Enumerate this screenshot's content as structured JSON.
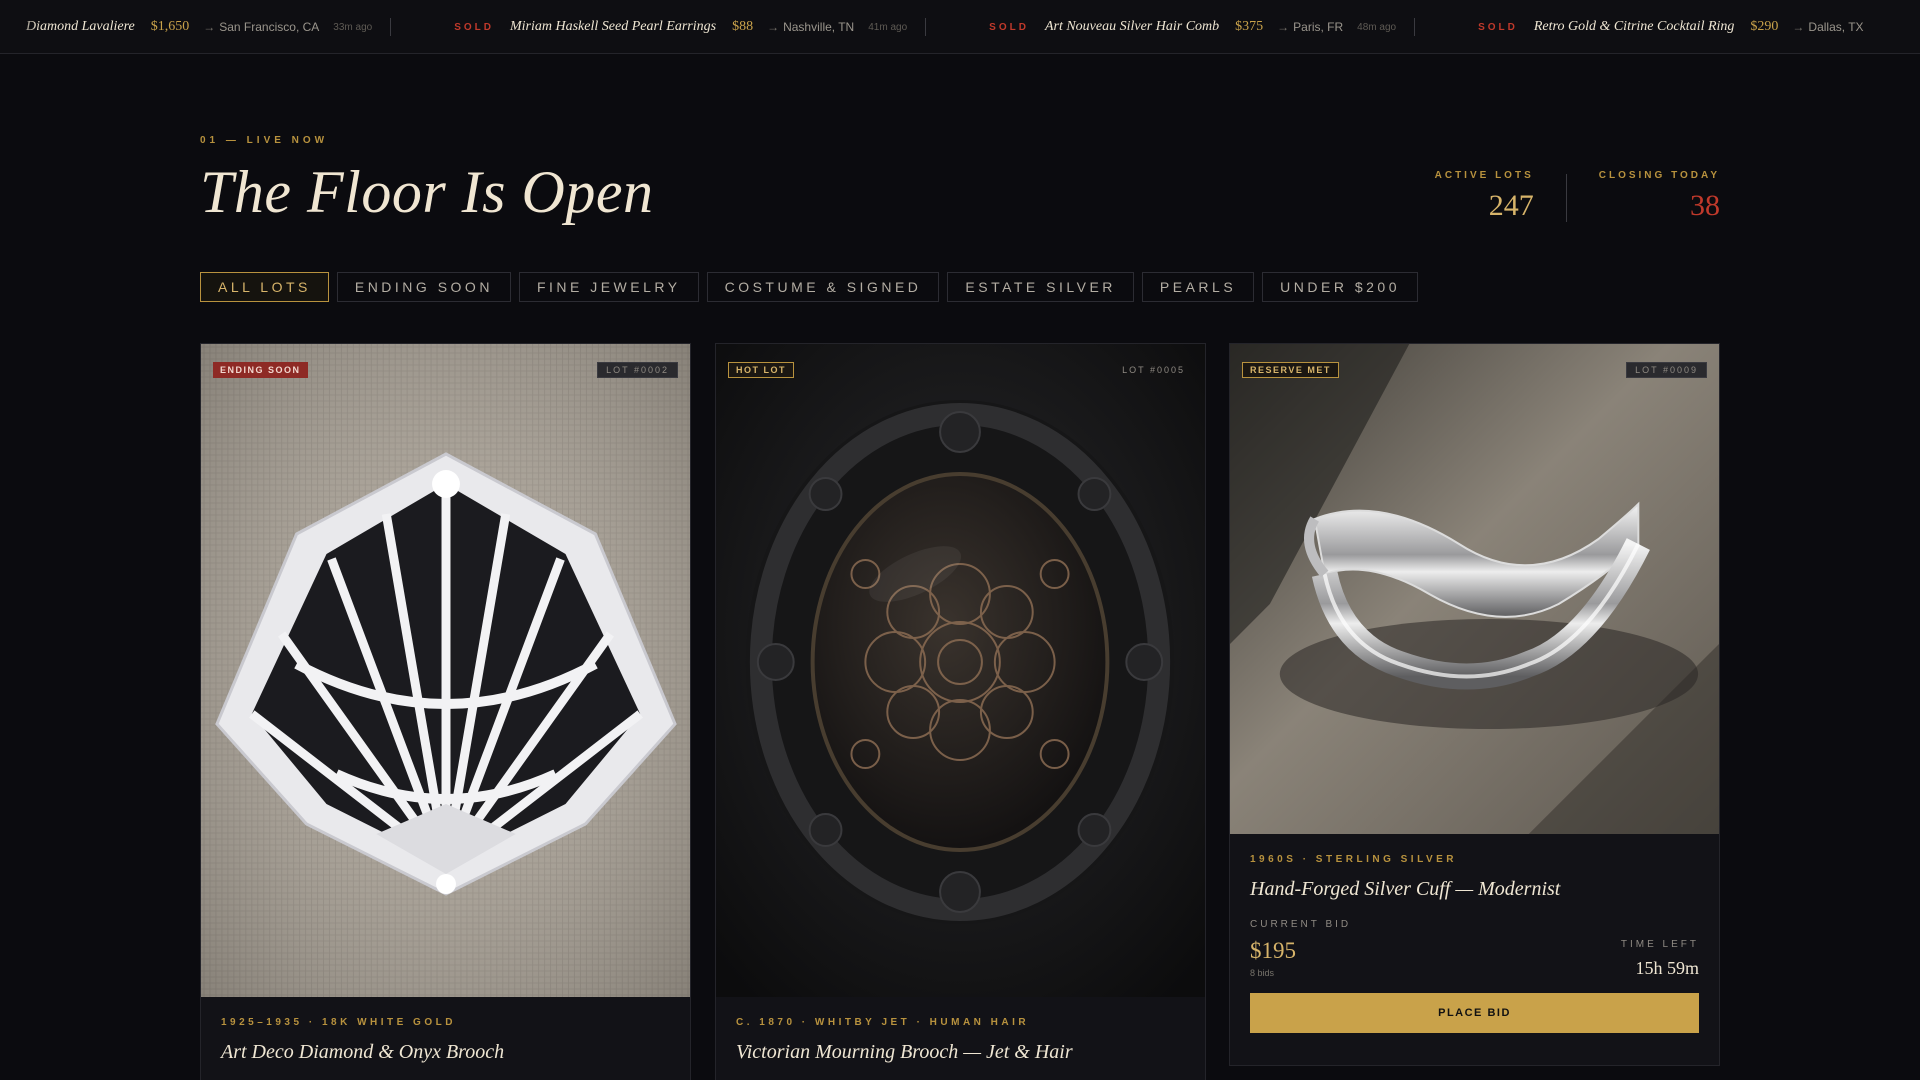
{
  "ticker": {
    "items": [
      {
        "status": "",
        "name": "Diamond Lavaliere",
        "price": "$1,650",
        "location": "San Francisco, CA",
        "time": "33m ago"
      },
      {
        "status": "SOLD",
        "name": "Miriam Haskell Seed Pearl Earrings",
        "price": "$88",
        "location": "Nashville, TN",
        "time": "41m ago"
      },
      {
        "status": "SOLD",
        "name": "Art Nouveau Silver Hair Comb",
        "price": "$375",
        "location": "Paris, FR",
        "time": "48m ago"
      },
      {
        "status": "SOLD",
        "name": "Retro Gold & Citrine Cocktail Ring",
        "price": "$290",
        "location": "Dallas, TX",
        "time": ""
      }
    ]
  },
  "header": {
    "eyebrow": "01 — LIVE NOW",
    "title": "The Floor Is Open"
  },
  "stats": {
    "active_label": "ACTIVE LOTS",
    "active_value": "247",
    "closing_label": "CLOSING TODAY",
    "closing_value": "38"
  },
  "filters": [
    "ALL LOTS",
    "ENDING SOON",
    "FINE JEWELRY",
    "COSTUME & SIGNED",
    "ESTATE SILVER",
    "PEARLS",
    "UNDER $200"
  ],
  "cards": [
    {
      "badge": "ENDING SOON",
      "lot": "LOT #0002",
      "meta": "1925–1935 · 18K WHITE GOLD",
      "title": "Art Deco Diamond & Onyx Brooch"
    },
    {
      "badge": "HOT LOT",
      "lot": "LOT #0005",
      "meta": "C. 1870 · WHITBY JET · HUMAN HAIR",
      "title": "Victorian Mourning Brooch — Jet & Hair"
    },
    {
      "badge": "RESERVE MET",
      "lot": "LOT #0009",
      "meta": "1960S · STERLING SILVER",
      "title": "Hand-Forged Silver Cuff — Modernist",
      "current_bid_label": "CURRENT BID",
      "current_bid": "$195",
      "bids": "8 bids",
      "time_left_label": "TIME LEFT",
      "time_left": "15h 59m",
      "button": "PLACE BID"
    }
  ],
  "colors": {
    "background": "#0b0b0f",
    "gold": "#c9a24a",
    "alert_red": "#c0392b"
  }
}
